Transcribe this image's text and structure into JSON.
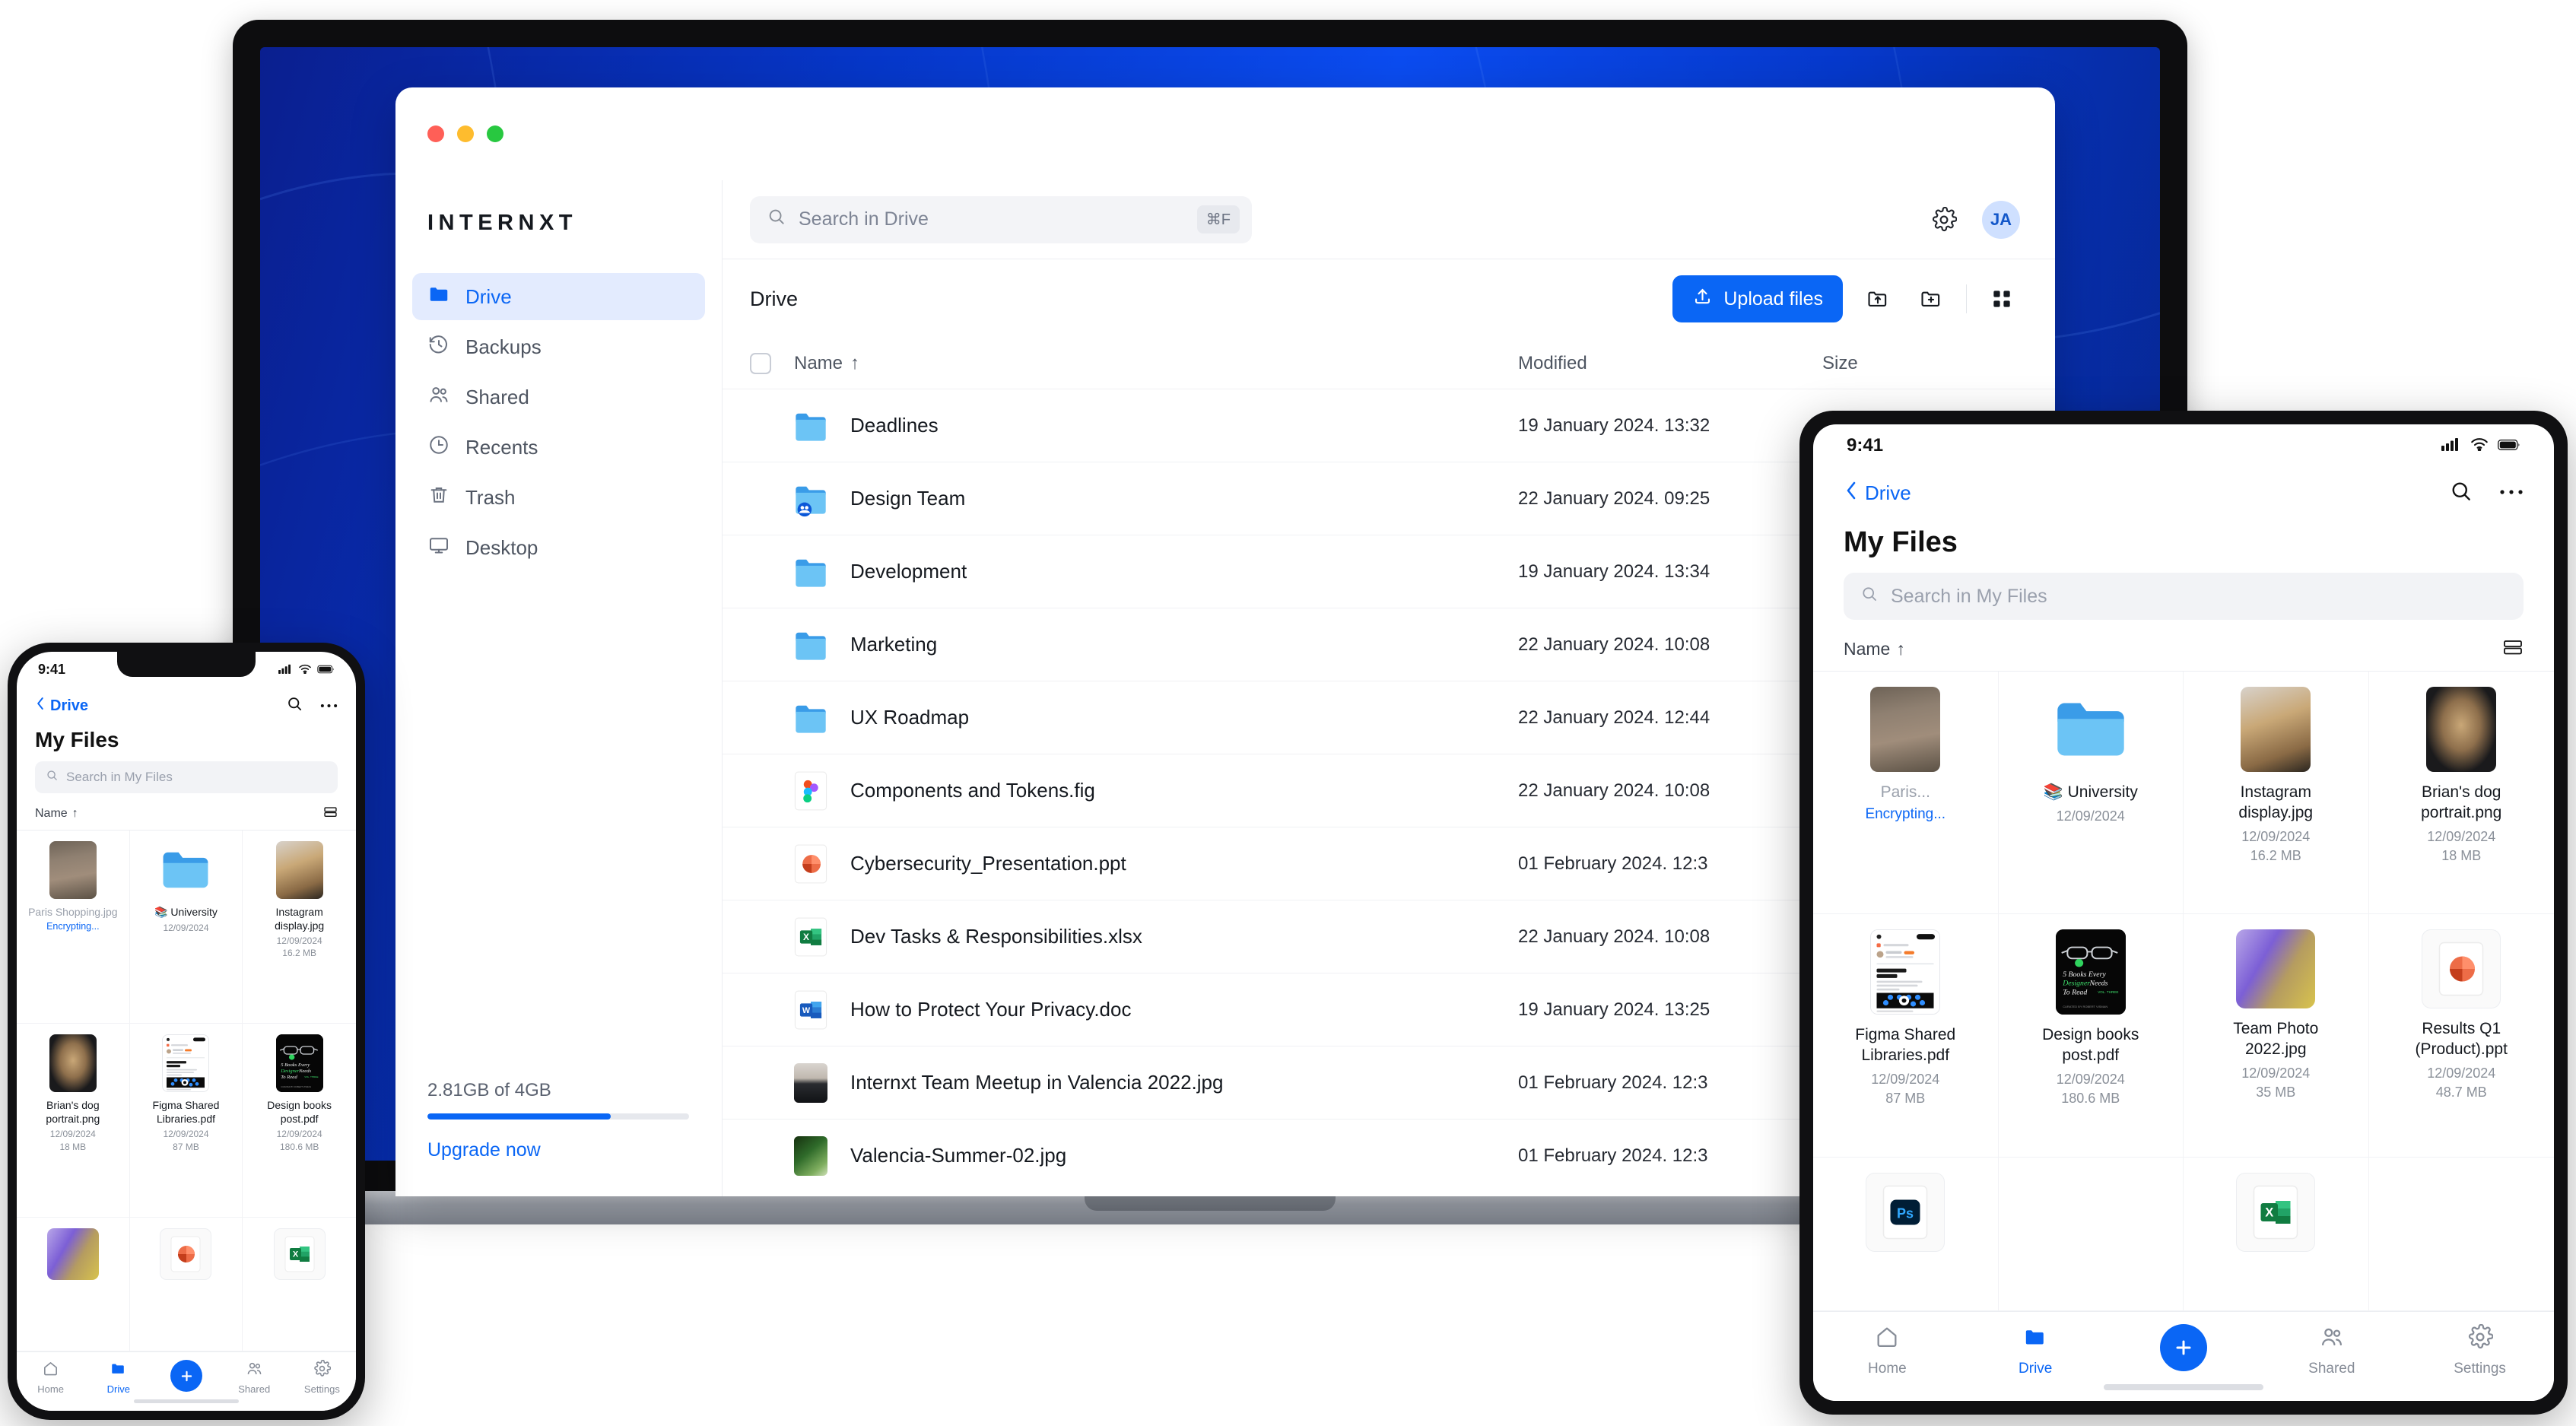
{
  "desktop": {
    "brand": "INTERNXT",
    "window_controls": [
      "close",
      "minimize",
      "maximize"
    ],
    "search": {
      "placeholder": "Search in Drive",
      "shortcut": "⌘F"
    },
    "account_initials": "JA",
    "sidebar": {
      "items": [
        {
          "label": "Drive",
          "icon": "folder-icon",
          "active": true
        },
        {
          "label": "Backups",
          "icon": "history-icon",
          "active": false
        },
        {
          "label": "Shared",
          "icon": "people-icon",
          "active": false
        },
        {
          "label": "Recents",
          "icon": "clock-icon",
          "active": false
        },
        {
          "label": "Trash",
          "icon": "trash-icon",
          "active": false
        },
        {
          "label": "Desktop",
          "icon": "monitor-icon",
          "active": false
        }
      ],
      "storage": {
        "used_label": "2.81GB of 4GB",
        "percent": 70,
        "upgrade_label": "Upgrade now",
        "bar_color": "#0a66f5"
      }
    },
    "toolbar": {
      "breadcrumb": "Drive",
      "upload_label": "Upload files",
      "upload_color": "#0a66f5",
      "actions": [
        "upload-folder-icon",
        "new-folder-icon",
        "grid-view-icon"
      ]
    },
    "table": {
      "columns": [
        "Name",
        "Modified",
        "Size"
      ],
      "sort_indicator": "↑",
      "rows": [
        {
          "name": "Deadlines",
          "modified": "19 January 2024. 13:32",
          "size": "",
          "icon": "folder"
        },
        {
          "name": "Design Team",
          "modified": "22 January 2024. 09:25",
          "size": "",
          "icon": "folder-shared"
        },
        {
          "name": "Development",
          "modified": "19 January 2024. 13:34",
          "size": "",
          "icon": "folder"
        },
        {
          "name": "Marketing",
          "modified": "22 January 2024. 10:08",
          "size": "",
          "icon": "folder"
        },
        {
          "name": "UX Roadmap",
          "modified": "22 January 2024. 12:44",
          "size": "",
          "icon": "folder"
        },
        {
          "name": "Components and Tokens.fig",
          "modified": "22 January 2024. 10:08",
          "size": "",
          "icon": "figma"
        },
        {
          "name": "Cybersecurity_Presentation.ppt",
          "modified": "01 February 2024. 12:3",
          "size": "",
          "icon": "powerpoint"
        },
        {
          "name": "Dev Tasks & Responsibilities.xlsx",
          "modified": "22 January 2024. 10:08",
          "size": "",
          "icon": "excel"
        },
        {
          "name": "How to Protect Your Privacy.doc",
          "modified": "19 January 2024. 13:25",
          "size": "",
          "icon": "word"
        },
        {
          "name": "Internxt Team Meetup in Valencia 2022.jpg",
          "modified": "01 February 2024. 12:3",
          "size": "",
          "icon": "photo-person"
        },
        {
          "name": "Valencia-Summer-02.jpg",
          "modified": "01 February 2024. 12:3",
          "size": "",
          "icon": "photo-valencia"
        }
      ]
    }
  },
  "tablet": {
    "status": {
      "time": "9:41",
      "icons": [
        "cellular-icon",
        "wifi-icon",
        "battery-icon"
      ]
    },
    "back_label": "Drive",
    "nav_actions": [
      "search-icon",
      "more-icon"
    ],
    "title": "My Files",
    "search_placeholder": "Search in My Files",
    "sort_label": "Name",
    "sort_indicator": "↑",
    "view_toggle": "list-view-icon",
    "items": [
      {
        "name": "Paris...",
        "date": "",
        "size": "",
        "status": "Encrypting...",
        "art": "art-paris",
        "shape": "portrait",
        "muted": true
      },
      {
        "name": "📚 University",
        "date": "12/09/2024",
        "size": "",
        "status": "",
        "art": "folder",
        "shape": "folder",
        "muted": false
      },
      {
        "name": "Instagram display.jpg",
        "date": "12/09/2024",
        "size": "16.2 MB",
        "status": "",
        "art": "art-insta",
        "shape": "portrait",
        "muted": false
      },
      {
        "name": "Brian's dog portrait.png",
        "date": "12/09/2024",
        "size": "18 MB",
        "status": "",
        "art": "art-dog",
        "shape": "portrait",
        "muted": false
      },
      {
        "name": "Figma Shared Libraries.pdf",
        "date": "12/09/2024",
        "size": "87 MB",
        "status": "",
        "art": "art-figma",
        "shape": "portrait",
        "muted": false
      },
      {
        "name": "Design books post.pdf",
        "date": "12/09/2024",
        "size": "180.6 MB",
        "status": "",
        "art": "art-books",
        "shape": "portrait",
        "muted": false
      },
      {
        "name": "Team Photo 2022.jpg",
        "date": "12/09/2024",
        "size": "35 MB",
        "status": "",
        "art": "art-team",
        "shape": "square",
        "muted": false
      },
      {
        "name": "Results Q1 (Product).ppt",
        "date": "12/09/2024",
        "size": "48.7 MB",
        "status": "",
        "art": "powerpoint",
        "shape": "square",
        "muted": false
      },
      {
        "name": "",
        "date": "",
        "size": "",
        "status": "",
        "art": "photoshop",
        "shape": "square",
        "muted": false
      },
      {
        "name": "",
        "date": "",
        "size": "",
        "status": "",
        "art": "none",
        "shape": "none",
        "muted": false
      },
      {
        "name": "",
        "date": "",
        "size": "",
        "status": "",
        "art": "excel",
        "shape": "square",
        "muted": false
      },
      {
        "name": "",
        "date": "",
        "size": "",
        "status": "",
        "art": "none",
        "shape": "none",
        "muted": false
      }
    ],
    "tabs": [
      {
        "label": "Home",
        "icon": "home-icon",
        "active": false
      },
      {
        "label": "Drive",
        "icon": "folder-icon",
        "active": true
      },
      {
        "label": "",
        "icon": "plus-icon",
        "active": false
      },
      {
        "label": "Shared",
        "icon": "people-icon",
        "active": false
      },
      {
        "label": "Settings",
        "icon": "gear-icon",
        "active": false
      }
    ]
  },
  "phone": {
    "status": {
      "time": "9:41",
      "icons": [
        "cellular-icon",
        "wifi-icon",
        "battery-icon"
      ]
    },
    "back_label": "Drive",
    "nav_actions": [
      "search-icon",
      "more-icon"
    ],
    "title": "My Files",
    "search_placeholder": "Search in My Files",
    "sort_label": "Name",
    "sort_indicator": "↑",
    "view_toggle": "list-view-icon",
    "items": [
      {
        "name": "Paris Shopping.jpg",
        "date": "",
        "size": "",
        "status": "Encrypting...",
        "art": "art-paris",
        "shape": "portrait",
        "muted": true
      },
      {
        "name": "📚 University",
        "date": "12/09/2024",
        "size": "",
        "status": "",
        "art": "folder",
        "shape": "folder",
        "muted": false
      },
      {
        "name": "Instagram display.jpg",
        "date": "12/09/2024",
        "size": "16.2 MB",
        "status": "",
        "art": "art-insta",
        "shape": "portrait",
        "muted": false
      },
      {
        "name": "Brian's dog portrait.png",
        "date": "12/09/2024",
        "size": "18 MB",
        "status": "",
        "art": "art-dog",
        "shape": "portrait",
        "muted": false
      },
      {
        "name": "Figma Shared Libraries.pdf",
        "date": "12/09/2024",
        "size": "87 MB",
        "status": "",
        "art": "art-figma",
        "shape": "portrait",
        "muted": false
      },
      {
        "name": "Design books post.pdf",
        "date": "12/09/2024",
        "size": "180.6 MB",
        "status": "",
        "art": "art-books",
        "shape": "portrait",
        "muted": false
      },
      {
        "name": "",
        "date": "",
        "size": "",
        "status": "",
        "art": "art-team",
        "shape": "square",
        "muted": false
      },
      {
        "name": "",
        "date": "",
        "size": "",
        "status": "",
        "art": "powerpoint",
        "shape": "square",
        "muted": false
      },
      {
        "name": "",
        "date": "",
        "size": "",
        "status": "",
        "art": "excel",
        "shape": "square",
        "muted": false
      }
    ],
    "tabs": [
      {
        "label": "Home",
        "icon": "home-icon",
        "active": false
      },
      {
        "label": "Drive",
        "icon": "folder-icon",
        "active": true
      },
      {
        "label": "",
        "icon": "plus-icon",
        "active": false
      },
      {
        "label": "Shared",
        "icon": "people-icon",
        "active": false
      },
      {
        "label": "Settings",
        "icon": "gear-icon",
        "active": false
      }
    ]
  }
}
